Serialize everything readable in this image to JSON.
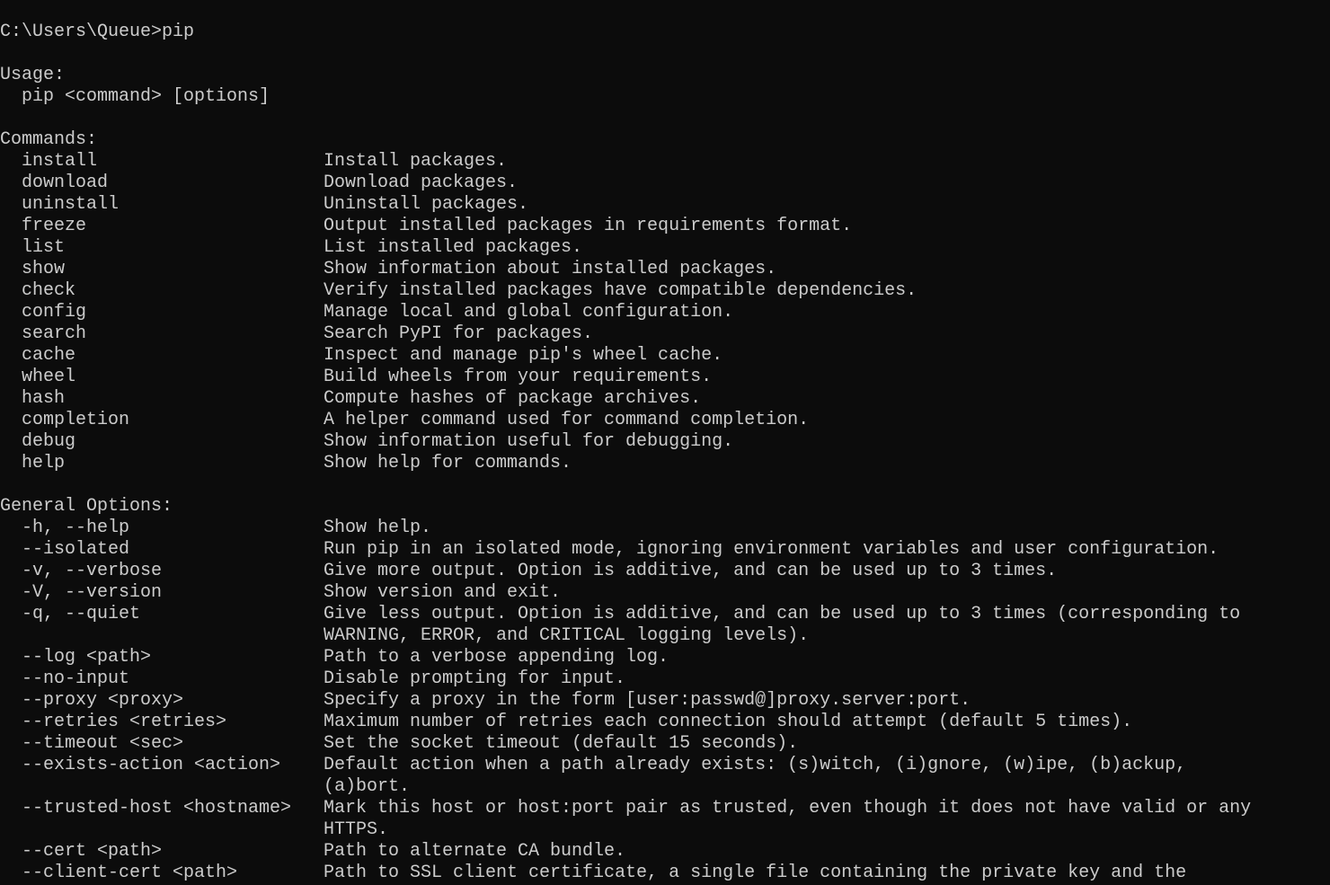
{
  "colors": {
    "background": "#0c0c0c",
    "text": "#cccccc"
  },
  "lines": [
    {
      "l": "C:\\Users\\Queue>pip",
      "r": ""
    },
    {
      "l": "",
      "r": ""
    },
    {
      "l": "Usage:",
      "r": ""
    },
    {
      "l": "  pip <command> [options]",
      "r": ""
    },
    {
      "l": "",
      "r": ""
    },
    {
      "l": "Commands:",
      "r": ""
    },
    {
      "l": "  install",
      "r": "Install packages."
    },
    {
      "l": "  download",
      "r": "Download packages."
    },
    {
      "l": "  uninstall",
      "r": "Uninstall packages."
    },
    {
      "l": "  freeze",
      "r": "Output installed packages in requirements format."
    },
    {
      "l": "  list",
      "r": "List installed packages."
    },
    {
      "l": "  show",
      "r": "Show information about installed packages."
    },
    {
      "l": "  check",
      "r": "Verify installed packages have compatible dependencies."
    },
    {
      "l": "  config",
      "r": "Manage local and global configuration."
    },
    {
      "l": "  search",
      "r": "Search PyPI for packages."
    },
    {
      "l": "  cache",
      "r": "Inspect and manage pip's wheel cache."
    },
    {
      "l": "  wheel",
      "r": "Build wheels from your requirements."
    },
    {
      "l": "  hash",
      "r": "Compute hashes of package archives."
    },
    {
      "l": "  completion",
      "r": "A helper command used for command completion."
    },
    {
      "l": "  debug",
      "r": "Show information useful for debugging."
    },
    {
      "l": "  help",
      "r": "Show help for commands."
    },
    {
      "l": "",
      "r": ""
    },
    {
      "l": "General Options:",
      "r": ""
    },
    {
      "l": "  -h, --help",
      "r": "Show help."
    },
    {
      "l": "  --isolated",
      "r": "Run pip in an isolated mode, ignoring environment variables and user configuration."
    },
    {
      "l": "  -v, --verbose",
      "r": "Give more output. Option is additive, and can be used up to 3 times."
    },
    {
      "l": "  -V, --version",
      "r": "Show version and exit."
    },
    {
      "l": "  -q, --quiet",
      "r": "Give less output. Option is additive, and can be used up to 3 times (corresponding to"
    },
    {
      "l": "",
      "r": "WARNING, ERROR, and CRITICAL logging levels)."
    },
    {
      "l": "  --log <path>",
      "r": "Path to a verbose appending log."
    },
    {
      "l": "  --no-input",
      "r": "Disable prompting for input."
    },
    {
      "l": "  --proxy <proxy>",
      "r": "Specify a proxy in the form [user:passwd@]proxy.server:port."
    },
    {
      "l": "  --retries <retries>",
      "r": "Maximum number of retries each connection should attempt (default 5 times)."
    },
    {
      "l": "  --timeout <sec>",
      "r": "Set the socket timeout (default 15 seconds)."
    },
    {
      "l": "  --exists-action <action>",
      "r": "Default action when a path already exists: (s)witch, (i)gnore, (w)ipe, (b)ackup,"
    },
    {
      "l": "",
      "r": "(a)bort."
    },
    {
      "l": "  --trusted-host <hostname>",
      "r": "Mark this host or host:port pair as trusted, even though it does not have valid or any"
    },
    {
      "l": "",
      "r": "HTTPS."
    },
    {
      "l": "  --cert <path>",
      "r": "Path to alternate CA bundle."
    },
    {
      "l": "  --client-cert <path>",
      "r": "Path to SSL client certificate, a single file containing the private key and the"
    }
  ]
}
